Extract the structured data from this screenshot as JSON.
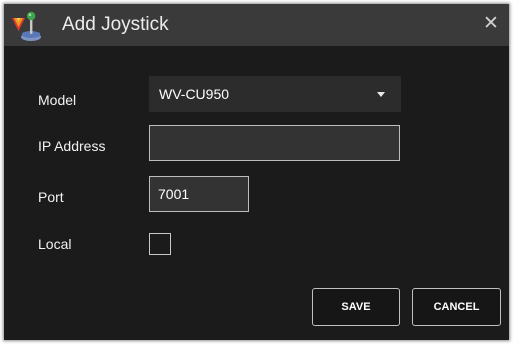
{
  "window": {
    "title": "Add Joystick",
    "close_glyph": "✕"
  },
  "form": {
    "model_label": "Model",
    "model_value": "WV-CU950",
    "ip_label": "IP Address",
    "ip_value": "",
    "port_label": "Port",
    "port_value": "7001",
    "local_label": "Local",
    "local_checked": false
  },
  "buttons": {
    "save": "SAVE",
    "cancel": "CANCEL"
  },
  "icons": {
    "app": "joystick-app-icon",
    "close": "close-icon",
    "dropdown": "chevron-down-icon"
  },
  "colors": {
    "dialog_bg": "#1b1b1b",
    "titlebar_bg": "#3a3a3a",
    "logo_orange": "#f29a1f",
    "logo_red": "#e23a2a",
    "joystick_blue": "#5a78b8",
    "joystick_green": "#3fa34d"
  }
}
